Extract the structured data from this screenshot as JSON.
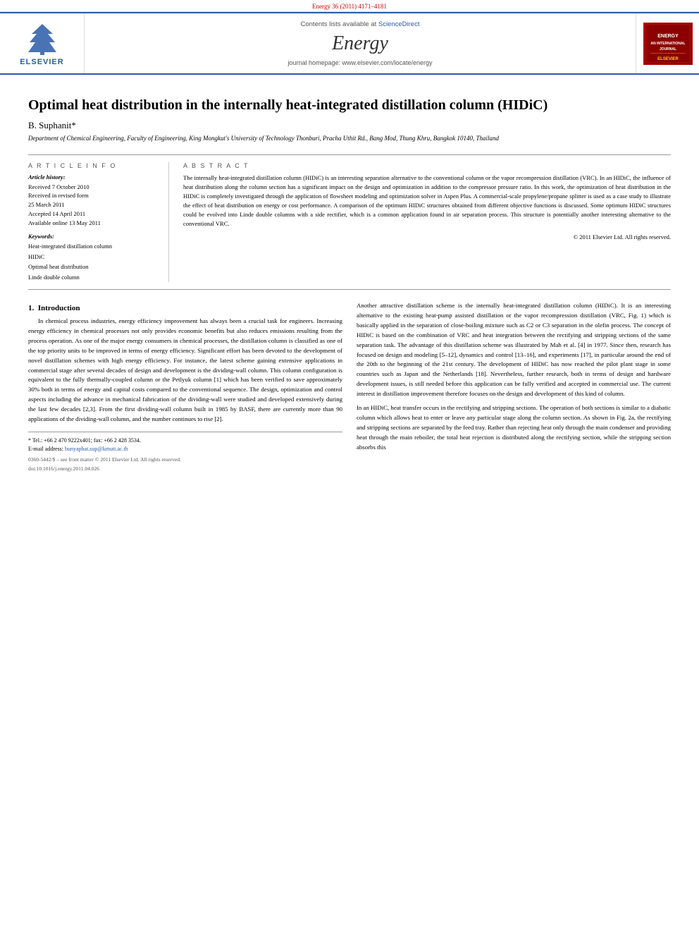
{
  "banner": {
    "text": "Energy 36 (2011) 4171–4181"
  },
  "journal_header": {
    "sciencedirect_prefix": "Contents lists available at ",
    "sciencedirect_link": "ScienceDirect",
    "journal_title": "Energy",
    "homepage_label": "journal homepage: www.elsevier.com/locate/energy",
    "elsevier_brand": "ELSEVIER"
  },
  "article": {
    "title": "Optimal heat distribution in the internally heat-integrated distillation column (HIDiC)",
    "author": "B. Suphanit*",
    "affiliation": "Department of Chemical Engineering, Faculty of Engineering, King Mongkut's University of Technology Thonburi, Pracha Uthit Rd., Bang Mod, Thung Khru, Bangkok 10140, Thailand",
    "article_info": {
      "section_label": "A R T I C L E   I N F O",
      "history_label": "Article history:",
      "history_items": [
        "Received 7 October 2010",
        "Received in revised form",
        "25 March 2011",
        "Accepted 14 April 2011",
        "Available online 13 May 2011"
      ],
      "keywords_label": "Keywords:",
      "keywords": [
        "Heat-integrated distillation column",
        "HIDiC",
        "Optimal heat distribution",
        "Linde double column"
      ]
    },
    "abstract": {
      "section_label": "A B S T R A C T",
      "text": "The internally heat-integrated distillation column (HIDiC) is an interesting separation alternative to the conventional column or the vapor recompression distillation (VRC). In an HIDiC, the influence of heat distribution along the column section has a significant impact on the design and optimization in addition to the compressor pressure ratio. In this work, the optimization of heat distribution in the HIDiC is completely investigated through the application of flowsheet modeling and optimization solver in Aspen Plus. A commercial-scale propylene/propane splitter is used as a case study to illustrate the effect of heat distribution on energy or cost performance. A comparison of the optimum HIDiC structures obtained from different objective functions is discussed. Some optimum HIDiC structures could be evolved into Linde double columns with a side rectifier, which is a common application found in air separation process. This structure is potentially another interesting alternative to the conventional VRC.",
      "copyright": "© 2011 Elsevier Ltd. All rights reserved."
    }
  },
  "body": {
    "introduction": {
      "section_number": "1.",
      "section_title": "Introduction",
      "paragraphs": [
        "In chemical process industries, energy efficiency improvement has always been a crucial task for engineers. Increasing energy efficiency in chemical processes not only provides economic benefits but also reduces emissions resulting from the process operation. As one of the major energy consumers in chemical processes, the distillation column is classified as one of the top priority units to be improved in terms of energy efficiency. Significant effort has been devoted to the development of novel distillation schemes with high energy efficiency. For instance, the latest scheme gaining extensive applications in commercial stage after several decades of design and development is the dividing-wall column. This column configuration is equivalent to the fully thermally-coupled column or the Petlyuk column [1] which has been verified to save approximately 30% both in terms of energy and capital costs compared to the conventional sequence. The design, optimization and control aspects including the advance in mechanical fabrication of the dividing-wall were studied and developed extensively during the last few decades [2,3]. From the first dividing-wall column built in 1985 by BASF, there are currently more than 90 applications of the dividing-wall column, and the number continues to rise [2]."
      ]
    },
    "right_col_paragraphs": [
      "Another attractive distillation scheme is the internally heat-integrated distillation column (HIDiC). It is an interesting alternative to the existing heat-pump assisted distillation or the vapor recompression distillation (VRC, Fig. 1) which is basically applied in the separation of close-boiling mixture such as C2 or C3 separation in the olefin process. The concept of HIDiC is based on the combination of VRC and heat integration between the rectifying and stripping sections of the same separation task. The advantage of this distillation scheme was illustrated by Mah et al. [4] in 1977. Since then, research has focused on design and modeling [5–12], dynamics and control [13–16], and experiments [17], in particular around the end of the 20th to the beginning of the 21st century. The development of HIDiC has now reached the pilot plant stage in some countries such as Japan and the Netherlands [18]. Nevertheless, further research, both in terms of design and hardware development issues, is still needed before this application can be fully verified and accepted in commercial use. The current interest in distillation improvement therefore focuses on the design and development of this kind of column.",
      "In an HIDiC, heat transfer occurs in the rectifying and stripping sections. The operation of both sections is similar to a diabatic column which allows heat to enter or leave any particular stage along the column section. As shown in Fig. 2a, the rectifying and stripping sections are separated by the feed tray. Rather than rejecting heat only through the main condenser and providing heat through the main reboiler, the total heat rejection is distributed along the rectifying section, while the stripping section absorbs this"
    ]
  },
  "footnote": {
    "tel_fax": "* Tel.: +66 2 470 9222x401; fax: +66 2 428 3534.",
    "email_label": "E-mail address:",
    "email": "bunyaphat.sup@kmutt.ac.th",
    "issn": "0360-5442/$ – see front matter © 2011 Elsevier Ltd. All rights reserved.",
    "doi": "doi:10.1016/j.energy.2011.04.026"
  }
}
